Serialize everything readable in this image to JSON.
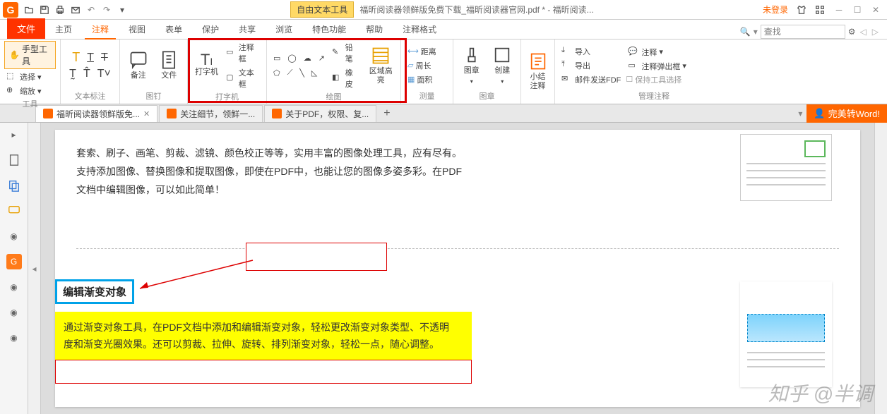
{
  "qat": {
    "undo": "↶",
    "redo": "↷"
  },
  "context_tool": "自由文本工具",
  "doc_title": "福昕阅读器领鲜版免费下载_福昕阅读器官网.pdf * - 福昕阅读...",
  "login": "未登录",
  "tabs": {
    "file": "文件",
    "home": "主页",
    "comment": "注释",
    "view": "视图",
    "form": "表单",
    "protect": "保护",
    "share": "共享",
    "browse": "浏览",
    "feature": "特色功能",
    "help": "帮助",
    "ctx": "注释格式"
  },
  "search_placeholder": "查找",
  "ribbon": {
    "tool": {
      "hand": "手型工具",
      "select": "选择",
      "zoom": "缩放",
      "label": "工具"
    },
    "textmark": {
      "label": "文本标注"
    },
    "pin": {
      "note": "备注",
      "file": "文件",
      "label": "图钉"
    },
    "type": {
      "typewriter": "打字机",
      "commentbox": "注释框",
      "textbox": "文本框",
      "label": "打字机"
    },
    "draw": {
      "pencil": "铅笔",
      "eraser": "橡皮",
      "area": "区域高亮",
      "label": "绘图"
    },
    "measure": {
      "dist": "距离",
      "perim": "周长",
      "area": "面积",
      "label": "测量"
    },
    "stamp": {
      "stamp": "图章",
      "create": "创建",
      "label": "图章"
    },
    "sum": {
      "summary": "小结注释",
      "label": ""
    },
    "manage": {
      "import": "导入",
      "export": "导出",
      "mail": "邮件发送FDF",
      "comment": "注释",
      "popup": "注释弹出框",
      "keep": "保持工具选择",
      "label": "管理注释"
    }
  },
  "doctabs": [
    {
      "label": "福昕阅读器领鲜版免...",
      "active": true
    },
    {
      "label": "关注细节，领鲜一...",
      "active": false
    },
    {
      "label": "关于PDF，权限、复...",
      "active": false
    }
  ],
  "convert": "完美转Word!",
  "content": {
    "p1": "套索、刷子、画笔、剪裁、滤镜、颜色校正等等，实用丰富的图像处理工具，应有尽有。",
    "p2": "支持添加图像、替换图像和提取图像，即使在PDF中，也能让您的图像多姿多彩。在PDF",
    "p3": "文档中编辑图像，可以如此简单！",
    "heading": "编辑渐变对象",
    "yp1": "通过渐变对象工具，在PDF文档中添加和编辑渐变对象，轻松更改渐变对象类型、不透明",
    "yp2": "度和渐变光圈效果。还可以剪裁、拉伸、旋转、排列渐变对象，轻松一点，随心调整。"
  },
  "watermark": "知乎 @半调"
}
